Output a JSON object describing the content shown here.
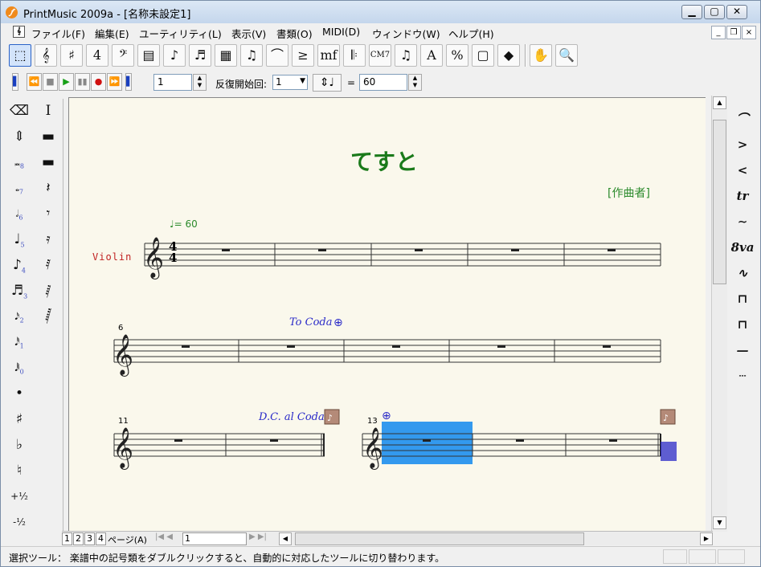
{
  "window": {
    "title": "PrintMusic 2009a - [名称未設定1]",
    "app_icon": "printmusic-logo-icon",
    "controls": [
      "minimize-icon",
      "maximize-icon",
      "close-icon"
    ]
  },
  "menu": [
    "ファイル(F)",
    "編集(E)",
    "ユーティリティ(L)",
    "表示(V)",
    "書類(O)",
    "MIDI(D)",
    "ウィンドウ(W)",
    "ヘルプ(H)"
  ],
  "toolbar": {
    "tools": [
      {
        "name": "selection-tool-icon",
        "glyph": "⬚"
      },
      {
        "name": "staff-tool-icon",
        "glyph": "𝄞"
      },
      {
        "name": "key-signature-tool-icon",
        "glyph": "♯"
      },
      {
        "name": "time-signature-tool-icon",
        "glyph": "4"
      },
      {
        "name": "clef-tool-icon",
        "glyph": "𝄢"
      },
      {
        "name": "measure-tool-icon",
        "glyph": "▤"
      },
      {
        "name": "simple-entry-tool-icon",
        "glyph": "♪"
      },
      {
        "name": "speedy-entry-tool-icon",
        "glyph": "♬"
      },
      {
        "name": "hyperscribe-tool-icon",
        "glyph": "▦"
      },
      {
        "name": "tuplet-tool-icon",
        "glyph": "♫"
      },
      {
        "name": "smart-shape-tool-icon",
        "glyph": "⌒"
      },
      {
        "name": "articulation-tool-icon",
        "glyph": "≥"
      },
      {
        "name": "expression-tool-icon",
        "glyph": "mf"
      },
      {
        "name": "repeat-tool-icon",
        "glyph": "𝄆"
      },
      {
        "name": "chord-tool-icon",
        "glyph": "CM7"
      },
      {
        "name": "lyrics-tool-icon",
        "glyph": "♫"
      },
      {
        "name": "text-tool-icon",
        "glyph": "A"
      },
      {
        "name": "resize-tool-icon",
        "glyph": "%"
      },
      {
        "name": "page-layout-tool-icon",
        "glyph": "▢"
      },
      {
        "name": "mirror-tool-icon",
        "glyph": "◆"
      },
      {
        "name": "hand-grabber-tool-icon",
        "glyph": "✋"
      },
      {
        "name": "zoom-tool-icon",
        "glyph": "🔍"
      }
    ]
  },
  "playback": {
    "buttons": [
      "rewind-to-start-icon",
      "rewind-icon",
      "stop-icon",
      "play-icon",
      "pause-icon",
      "record-icon",
      "fast-forward-icon",
      "fast-forward-end-icon"
    ],
    "measure_value": "1",
    "repeat_label": "反復開始回:",
    "repeat_value": "1",
    "tempo_equals": "=",
    "tempo_value": "60"
  },
  "left_palette": [
    [
      "eraser-icon",
      "I"
    ],
    [
      "up-down-arrows-icon",
      "—"
    ],
    [
      "double-whole-note-icon",
      "–"
    ],
    [
      "whole-note-icon",
      "𝄽"
    ],
    [
      "half-note-icon",
      "𝄾"
    ],
    [
      "quarter-note-icon",
      "𝄿"
    ],
    [
      "eighth-note-icon",
      "𝅀"
    ],
    [
      "sixteenth-note-icon",
      "𝅁"
    ],
    [
      "thirty-second-note-icon",
      "𝅂"
    ],
    [
      "sixty-fourth-note-icon",
      ""
    ],
    [
      "one-twenty-eighth-note-icon",
      ""
    ],
    [
      "dot-icon",
      ""
    ],
    [
      "sharp-icon",
      ""
    ],
    [
      "flat-icon",
      ""
    ],
    [
      "natural-icon",
      ""
    ],
    [
      "half-step-up-icon",
      ""
    ],
    [
      "half-step-down-icon",
      ""
    ]
  ],
  "left_palette_labels": {
    "col1": [
      "",
      "",
      "8",
      "7",
      "6",
      "5",
      "4",
      "3",
      "2",
      "1",
      "0",
      "",
      "♯",
      "♭",
      "♮",
      "+½",
      "-½"
    ],
    "col1_glyphs": [
      "⌫",
      "⇕",
      "𝅜",
      "𝅝",
      "𝅗𝅥",
      "♩",
      "♪",
      "♬",
      "𝅘𝅥𝅯",
      "𝅘𝅥𝅰",
      "𝅘𝅥𝅱",
      "•",
      "♯",
      "♭",
      "♮",
      "+½",
      "-½"
    ]
  },
  "right_palette": [
    "slur-icon",
    "crescendo-hairpin-icon",
    "decrescendo-hairpin-icon",
    "trill-icon",
    "trill-extension-icon",
    "octave-sign-icon",
    "glissando-icon",
    "bracket-open-icon",
    "bracket-close-icon",
    "line-icon",
    "dashed-line-icon"
  ],
  "right_palette_glyphs": [
    "⌒",
    ">",
    "<",
    "tr",
    "∼",
    "8va",
    "∿",
    "⊓",
    "⊓",
    "—",
    "┄"
  ],
  "score": {
    "title": "てすと",
    "composer": "[作曲者]",
    "tempo_mark": "♩= 60",
    "instrument": "Violin",
    "time_sig_top": "4",
    "time_sig_bottom": "4",
    "system2_number": "6",
    "to_coda": "To Coda",
    "system3_number": "11",
    "dc_al_coda": "D.C. al Coda",
    "system4_number": "13",
    "title_color": "#1a7a1a",
    "composer_color": "#2b8a2b",
    "tempo_color": "#2b8a2b",
    "instrument_color": "#c02020",
    "repeat_text_color": "#2a2ac8",
    "selection_color": "#3399ee"
  },
  "page_nav": {
    "tabs": [
      "1",
      "2",
      "3",
      "4"
    ],
    "page_label": "ページ(A)",
    "page_value": "1"
  },
  "status": "選択ツール： 楽譜中の記号類をダブルクリックすると、自動的に対応したツールに切り替わります。"
}
